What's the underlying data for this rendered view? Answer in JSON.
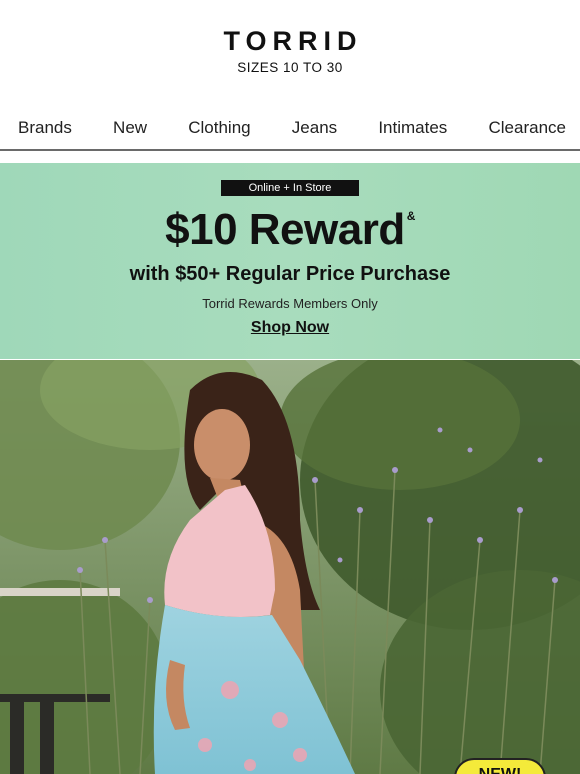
{
  "header": {
    "logo": "TORRID",
    "tagline": "SIZES 10 TO 30"
  },
  "nav": {
    "items": [
      {
        "label": "Brands"
      },
      {
        "label": "New"
      },
      {
        "label": "Clothing"
      },
      {
        "label": "Jeans"
      },
      {
        "label": "Intimates"
      },
      {
        "label": "Clearance"
      }
    ]
  },
  "promo": {
    "badge": "Online + In Store",
    "amount": "$10 Reward",
    "amount_mark": "&",
    "subhead": "with $50+ Regular Price Purchase",
    "note": "Torrid Rewards Members Only",
    "cta": "Shop Now",
    "bg_color": "#a3dabb"
  },
  "hero": {
    "badge": "NEW!",
    "badge_color": "#f4ea3a"
  }
}
